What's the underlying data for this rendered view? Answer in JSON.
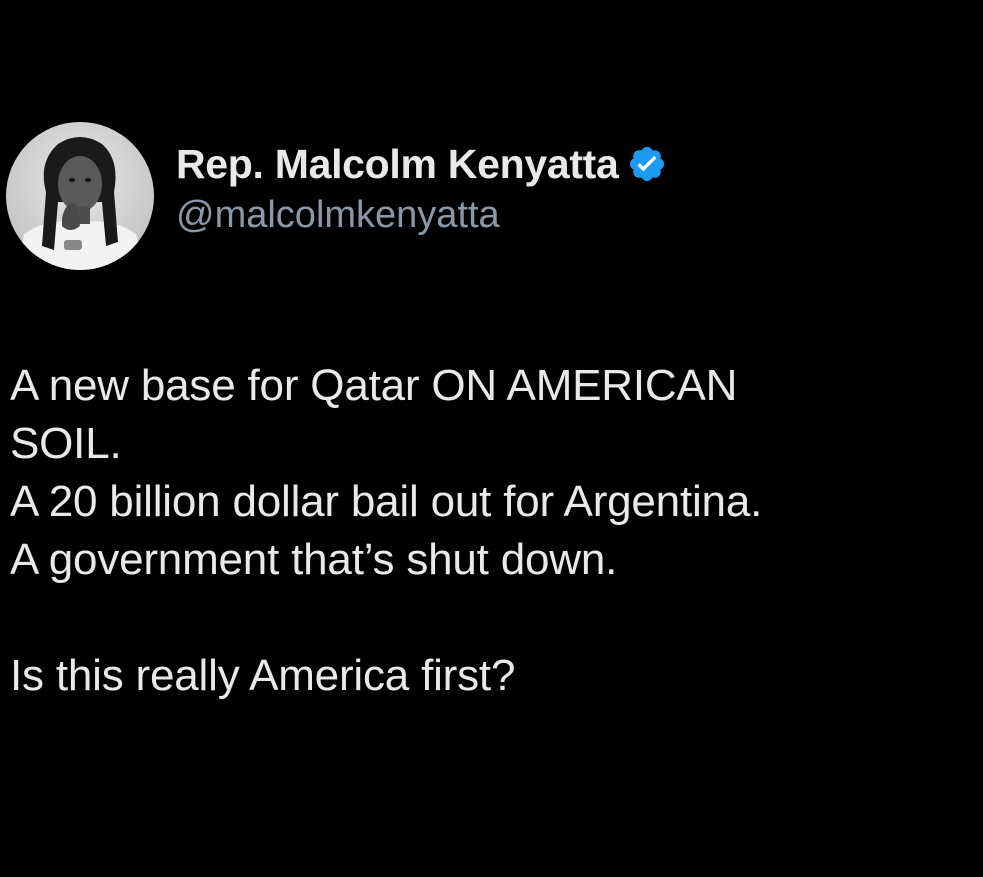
{
  "author": {
    "display_name": "Rep. Malcolm Kenyatta",
    "handle": "@malcolmkenyatta",
    "verified_badge_color": "#1d9bf0",
    "avatar_icon": "profile-photo"
  },
  "tweet": {
    "lines": [
      "A new base for Qatar ON AMERICAN",
      "SOIL.",
      "A 20 billion dollar bail out for Argentina.",
      "A government that’s shut down.",
      "",
      "Is this really America first?"
    ]
  },
  "colors": {
    "background": "#000000",
    "primary_text": "#e7e9ea",
    "secondary_text": "#8b98a5"
  }
}
